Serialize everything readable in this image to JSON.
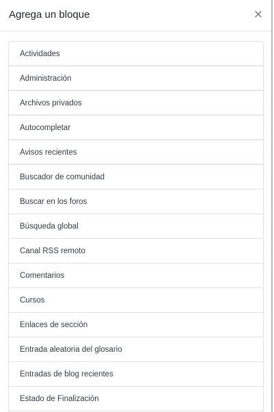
{
  "modal": {
    "title": "Agrega un bloque",
    "close_symbol": "×"
  },
  "blocks": [
    "Actividades",
    "Administración",
    "Archivos privados",
    "Autocompletar",
    "Avisos recientes",
    "Buscador de comunidad",
    "Buscar en los foros",
    "Búsqueda global",
    "Canal RSS remoto",
    "Comentarios",
    "Cursos",
    "Enlaces de sección",
    "Entrada aleatoria del glosario",
    "Entradas de blog recientes",
    "Estado de Finalización"
  ]
}
